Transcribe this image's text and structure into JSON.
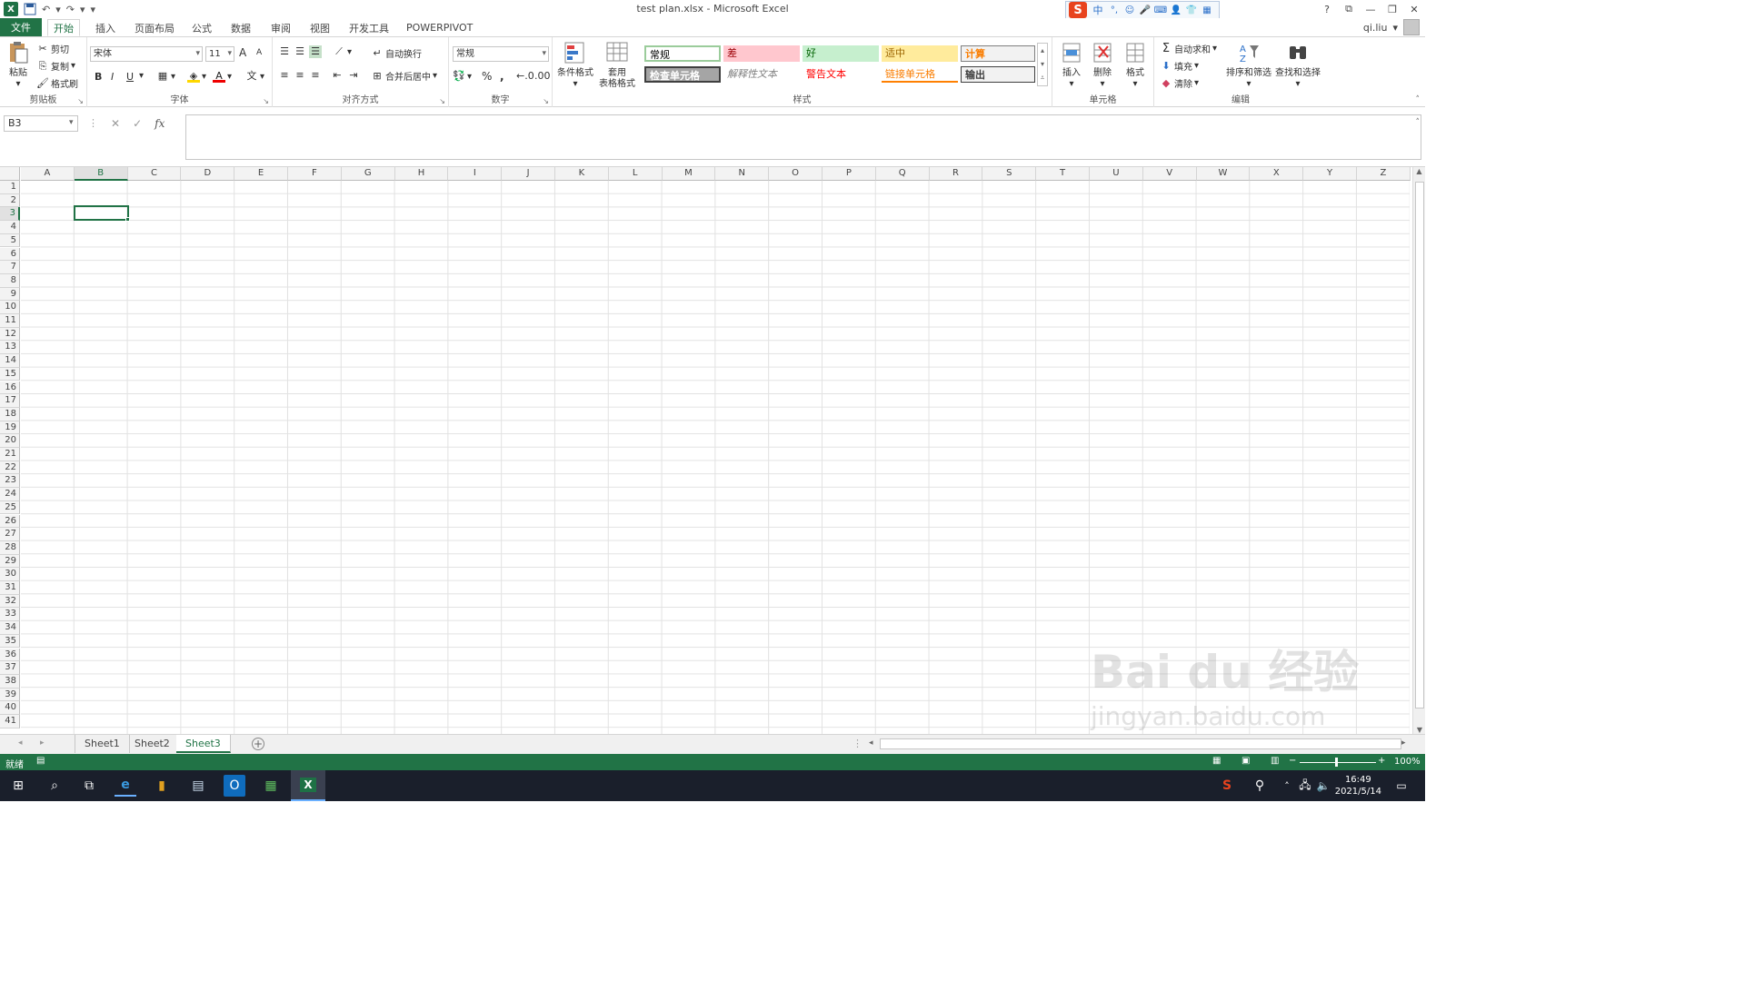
{
  "title": "test plan.xlsx - Microsoft Excel",
  "colors": {
    "accent": "#217346",
    "grid": "#e2e2e2"
  },
  "qat": {
    "logo": "X",
    "save_icon": "save-icon",
    "undo": "↶",
    "redo": "↷",
    "customize": "▾"
  },
  "ime": {
    "label": "中",
    "s": "S"
  },
  "window_controls": [
    "?",
    "⧉",
    "—",
    "❐",
    "✕"
  ],
  "tabs": [
    {
      "label": "文件"
    },
    {
      "label": "开始"
    },
    {
      "label": "插入"
    },
    {
      "label": "页面布局"
    },
    {
      "label": "公式"
    },
    {
      "label": "数据"
    },
    {
      "label": "审阅"
    },
    {
      "label": "视图"
    },
    {
      "label": "开发工具"
    },
    {
      "label": "POWERPIVOT"
    }
  ],
  "user": {
    "name": "qi.liu"
  },
  "ribbon": {
    "clipboard": {
      "label": "剪贴板",
      "paste": "粘贴",
      "cut": "剪切",
      "copy": "复制",
      "format_painter": "格式刷"
    },
    "font": {
      "label": "字体",
      "font_name": "宋体",
      "font_size": "11",
      "bold": "B",
      "italic": "I",
      "underline": "U",
      "grow": "A",
      "shrink": "A"
    },
    "alignment": {
      "label": "对齐方式",
      "wrap": "自动换行",
      "merge": "合并后居中"
    },
    "number": {
      "label": "数字",
      "format": "常规",
      "percent": "%",
      "comma": ","
    },
    "styles": {
      "label": "样式",
      "cond_format": "条件格式",
      "table_format_1": "套用",
      "table_format_2": "表格格式",
      "cells": [
        {
          "text": "常规"
        },
        {
          "text": "差"
        },
        {
          "text": "好"
        },
        {
          "text": "适中"
        },
        {
          "text": "计算"
        },
        {
          "text": "检查单元格"
        },
        {
          "text": "解释性文本"
        },
        {
          "text": "警告文本"
        },
        {
          "text": "链接单元格"
        },
        {
          "text": "输出"
        }
      ]
    },
    "cells_group": {
      "label": "单元格",
      "insert": "插入",
      "delete": "删除",
      "format": "格式"
    },
    "editing": {
      "label": "编辑",
      "autosum": "自动求和",
      "fill": "填充",
      "clear": "清除",
      "sort": "排序和筛选",
      "find": "查找和选择"
    }
  },
  "formula_bar": {
    "name_box": "B3",
    "fx": "fx",
    "value": ""
  },
  "columns": [
    "A",
    "B",
    "C",
    "D",
    "E",
    "F",
    "G",
    "H",
    "I",
    "J",
    "K",
    "L",
    "M",
    "N",
    "O",
    "P",
    "Q",
    "R",
    "S",
    "T",
    "U",
    "V",
    "W",
    "X",
    "Y",
    "Z"
  ],
  "rows": [
    "1",
    "2",
    "3",
    "4",
    "5",
    "6",
    "7",
    "8",
    "9",
    "10",
    "11",
    "12",
    "13",
    "14",
    "15",
    "16",
    "17",
    "18",
    "19",
    "20",
    "21",
    "22",
    "23",
    "24",
    "25",
    "26",
    "27",
    "28",
    "29",
    "30",
    "31",
    "32",
    "33",
    "34",
    "35",
    "36",
    "37",
    "38",
    "39",
    "40",
    "41"
  ],
  "selected": {
    "col": "B",
    "row": "3"
  },
  "sheets": [
    {
      "name": "Sheet1"
    },
    {
      "name": "Sheet2"
    },
    {
      "name": "Sheet3"
    }
  ],
  "active_sheet": "Sheet3",
  "status": {
    "ready": "就绪",
    "zoom": "100%"
  },
  "taskbar": {
    "time": "16:49",
    "date": "2021/5/14"
  },
  "watermark": {
    "line1": "Bai du 经验",
    "line2": "jingyan.baidu.com"
  }
}
